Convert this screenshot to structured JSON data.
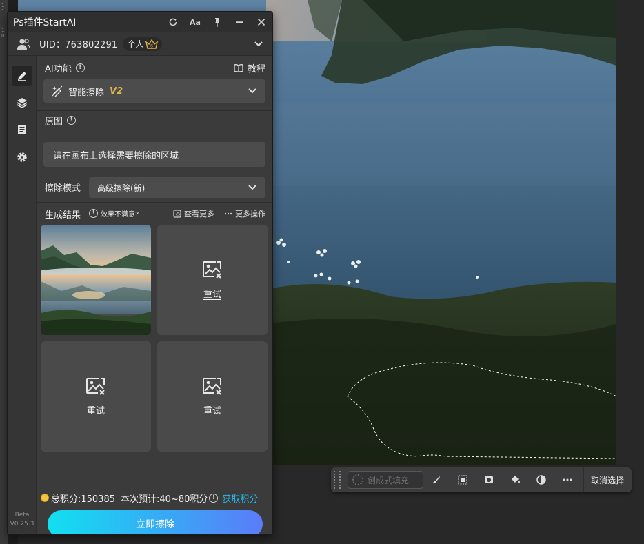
{
  "panel": {
    "title": "Ps插件StartAI",
    "user": {
      "uid_label": "UID：763802291",
      "plan_label": "个人"
    },
    "ai_function": {
      "label": "AI功能",
      "tutorial_label": "教程",
      "selected_tool": "智能擦除",
      "tool_version": "V2"
    },
    "original": {
      "label": "原图",
      "hint": "请在画布上选择需要擦除的区域"
    },
    "erase_mode": {
      "label": "擦除模式",
      "selected": "高级擦除(新)"
    },
    "results": {
      "label": "生成结果",
      "unsatisfied_label": "效果不满意?",
      "view_more_label": "查看更多",
      "more_actions_label": "更多操作",
      "retry_label": "重试"
    },
    "credits": {
      "total_label": "总积分:150385",
      "estimate_label": "本次预计:40~80积分",
      "get_credits_label": "获取积分"
    },
    "erase_button_label": "立即擦除",
    "version": {
      "stage": "Beta",
      "number": "V0.25.3"
    }
  },
  "photoshop": {
    "taskbar": {
      "generative_fill_label": "创成式填充",
      "deselect_label": "取消选择"
    }
  },
  "colors": {
    "accent_blue": "#27b8f0",
    "button_gradient_start": "#12e0f0",
    "button_gradient_end": "#5b7cf8",
    "version_tag": "#e2b24a"
  },
  "icons": [
    "refresh-icon",
    "font-size-icon",
    "pin-icon",
    "minimize-icon",
    "close-icon",
    "users-icon",
    "crown-icon",
    "chevron-down-icon",
    "pencil-icon",
    "layers-icon",
    "notes-icon",
    "gear-icon",
    "info-icon",
    "book-icon",
    "magic-eraser-icon",
    "image-broken-icon",
    "history-icon",
    "more-icon"
  ]
}
